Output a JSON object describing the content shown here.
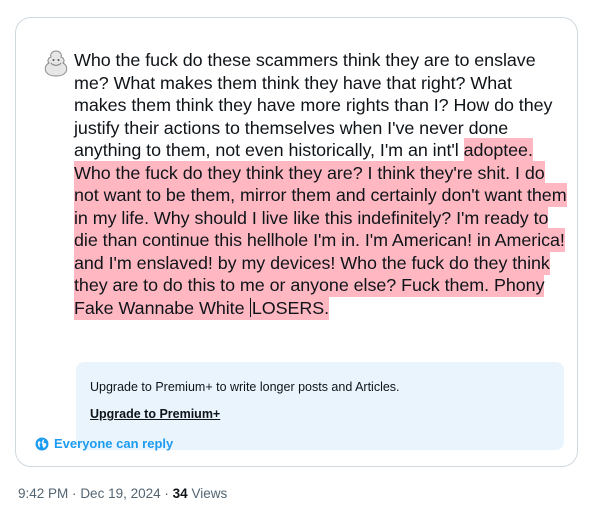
{
  "compose": {
    "text_normal": "Who the fuck do these scammers think they are to enslave me? What makes them think they have that right? What makes them think they have more rights than I? How do they justify their actions to themselves when I've never done anything to them, not even historically, I'm an int'l ",
    "text_over_before_caret": "adoptee. Who the fuck do they think they are? I think they're shit. I do not want to be them, mirror them and certainly don't want them in my life. Why should I live like this indefinitely? I'm ready to die than continue this hellhole I'm in. I'm American! in America! and I'm enslaved! by my devices! Who the fuck do they think they are to do this to me or anyone else? Fuck them. Phony Fake Wannabe White ",
    "text_over_after_caret": "LOSERS."
  },
  "upsell": {
    "message": "Upgrade to Premium+ to write longer posts and Articles.",
    "link_label": "Upgrade to Premium+"
  },
  "reply_setting": {
    "label": "Everyone can reply",
    "icon": "globe-icon"
  },
  "meta": {
    "time": "9:42 PM",
    "separator": "·",
    "date": "Dec 19, 2024",
    "views_count": "34",
    "views_label": "Views"
  },
  "colors": {
    "over_limit_highlight": "#ffb8c2",
    "accent": "#1d9bf0",
    "upsell_bg": "#e9f4fd",
    "text_primary": "#0f1419",
    "text_secondary": "#536471"
  }
}
